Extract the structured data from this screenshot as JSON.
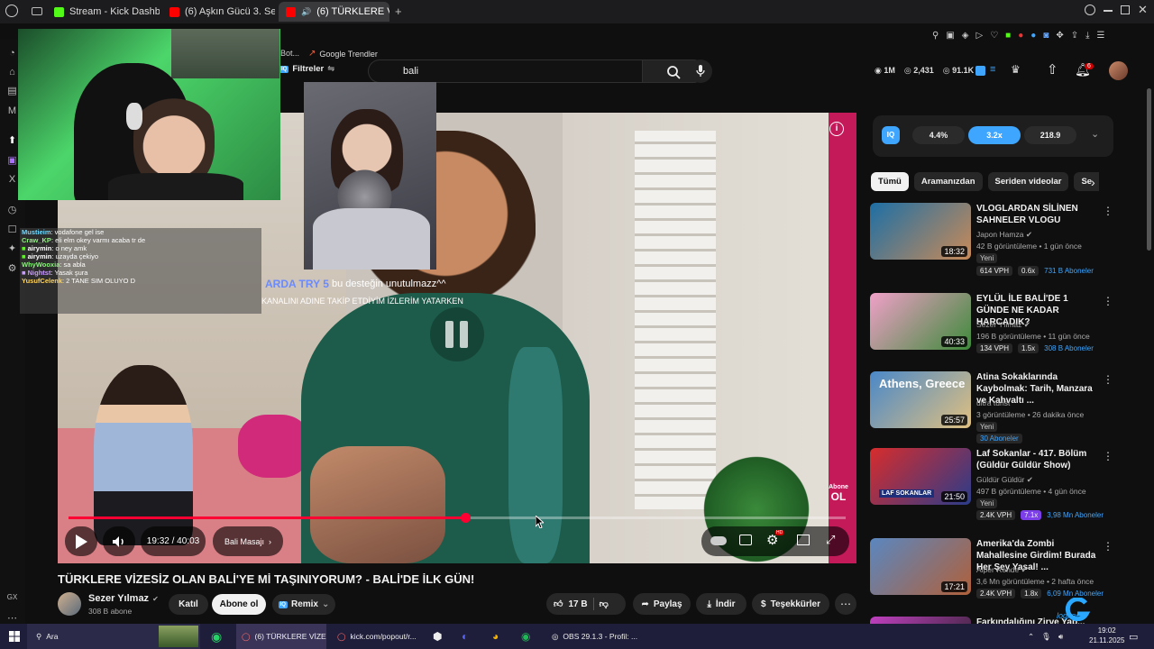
{
  "browser": {
    "tabs": [
      {
        "label": "Stream - Kick Dashboard",
        "color": "#53fc18"
      },
      {
        "label": "(6) Aşkın Gücü 3. Sezon",
        "color": "#ff0000"
      },
      {
        "label": "(6) TÜRKLERE VİZES",
        "color": "#ff0000"
      }
    ],
    "bookmarks": [
      "Bot...",
      "Google Trendler"
    ]
  },
  "youtube": {
    "filters_label": "Filtreler",
    "search_value": "bali",
    "stats": {
      "views": "1M",
      "likes": "2,431",
      "other": "91.1K"
    },
    "notif_count": "6"
  },
  "player": {
    "time_current": "19:32",
    "time_total": "40:03",
    "time_sep": " / ",
    "chapter": "Bali Masajı",
    "subscribe_watermark_line1": "Abone",
    "subscribe_watermark_line2": "OL",
    "progress_fraction": 0.51
  },
  "overlay": {
    "donation_name": "ARDA TRY 5",
    "donation_msg": "bu desteğin unutulmazz^^",
    "ticker": "KANALINI ADINE TAKİP ETDİYİM İZLERİM YATARKEN",
    "chat": [
      {
        "user": "Mustieim",
        "msg": ": vodafone gel ise",
        "color": "#6fd8ff"
      },
      {
        "user": "Craw_KP",
        "msg": ": eli elm okey varmı acaba tr de",
        "color": "#8cf27e"
      },
      {
        "user": "airymin",
        "msg": ": o ney amk",
        "color": "#ffffff"
      },
      {
        "user": "airymin",
        "msg": ": uzayda çekiyo",
        "color": "#ffffff"
      },
      {
        "user": "WhyWooxia",
        "msg": ": sa abla",
        "color": "#8cf27e"
      },
      {
        "user": "Nightst",
        "msg": ": Yasak şura",
        "color": "#c89bff"
      },
      {
        "user": "YusufCelenk",
        "msg": ": 2 TANE SIM OLUYO D",
        "color": "#ffd35a"
      }
    ]
  },
  "video": {
    "title": "TÜRKLERE VİZESİZ OLAN BALİ'YE Mİ TAŞINIYORUM? - BALİ'DE İLK GÜN!",
    "channel": "Sezer Yılmaz",
    "subscribers": "308 B abone",
    "join_label": "Katıl",
    "subscribe_label": "Abone ol",
    "remix_label": "Remix",
    "likes": "17 B",
    "share_label": "Paylaş",
    "download_label": "İndir",
    "thanks_label": "Teşekkürler"
  },
  "iq": {
    "badge": "IQ",
    "values": [
      "4.4%",
      "3.2x",
      "218.9"
    ]
  },
  "chips": [
    "Tümü",
    "Aramanızdan",
    "Seriden videolar",
    "Se"
  ],
  "recommended": [
    {
      "title": "VLOGLARDAN SİLİNEN SAHNELER VLOGU",
      "channel": "Japon Hamza",
      "meta": "42 B görüntüleme • 1 gün önce",
      "badge": "Yeni",
      "duration": "18:32",
      "vph": "614 VPH",
      "mult": "0.6x",
      "subs": "731 B Aboneler",
      "colors": [
        "#1d6fa5",
        "#c98a58"
      ]
    },
    {
      "title": "EYLÜL İLE BALİ'DE 1 GÜNDE NE KADAR HARCADIK?",
      "channel": "Sezer Yılmaz",
      "meta": "196 B görüntüleme • 11 gün önce",
      "badge": "",
      "duration": "40:33",
      "vph": "134 VPH",
      "mult": "1.5x",
      "subs": "308 B Aboneler",
      "colors": [
        "#f0a0c8",
        "#3d8a3a"
      ]
    },
    {
      "title": "Atina Sokaklarında Kaybolmak: Tarih, Manzara ve Kahvaltı ...",
      "channel": "ultra turist",
      "meta": "3 görüntüleme • 26 dakika önce",
      "badge": "Yeni",
      "duration": "25:57",
      "vph": "",
      "mult": "",
      "subs": "30 Aboneler",
      "colors": [
        "#4a88c8",
        "#e0c080"
      ]
    },
    {
      "title": "Laf Sokanlar - 417. Bölüm (Güldür Güldür Show)",
      "channel": "Güldür Güldür",
      "meta": "497 B görüntüleme • 4 gün önce",
      "badge": "Yeni",
      "duration": "21:50",
      "vph": "2.4K VPH",
      "mult": "7.1x",
      "subs": "3,98 Mn Aboneler",
      "colors": [
        "#d82c2c",
        "#2a3c8a"
      ]
    },
    {
      "title": "Amerika'da Zombi Mahallesine Girdim! Burada Her Şey Yasal! ...",
      "channel": "Alper Rende",
      "meta": "3,6 Mn görüntüleme • 2 hafta önce",
      "badge": "",
      "duration": "17:21",
      "vph": "2.4K VPH",
      "mult": "1.8x",
      "subs": "6,09 Mn Aboneler",
      "colors": [
        "#5a87c0",
        "#b0603a"
      ]
    },
    {
      "title": "Farkındalığını Zirve Yap...",
      "channel": "",
      "meta": "",
      "badge": "",
      "duration": "",
      "vph": "",
      "mult": "",
      "subs": "",
      "colors": [
        "#c040c0",
        "#202020"
      ]
    }
  ],
  "taskbar": {
    "search_label": "Ara",
    "apps": [
      "(6) TÜRKLERE VİZES...",
      "kick.com/popout/r...",
      "OBS 29.1.3 - Profil: ..."
    ],
    "time": "19:02",
    "date": "21.11.2025",
    "logo_text": "logitech"
  },
  "colors": {
    "accent": "#3ea6ff",
    "youtube_red": "#ff0000",
    "kick_green": "#53fc18"
  }
}
